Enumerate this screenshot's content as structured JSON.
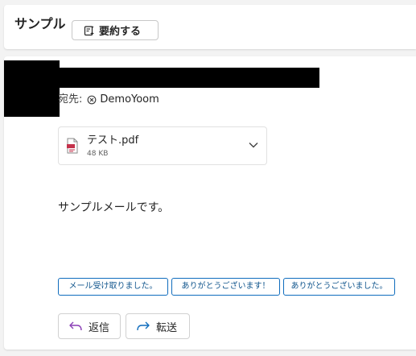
{
  "header": {
    "subject": "サンプル",
    "summarize_label": "要約する"
  },
  "message": {
    "to_label": "宛先:",
    "recipient": "DemoYoom",
    "attachment": {
      "name": "テスト.pdf",
      "size": "48 KB"
    },
    "body": "サンプルメールです。"
  },
  "quick_replies": [
    {
      "label": "メール受け取りました。"
    },
    {
      "label": "ありがとうございます！"
    },
    {
      "label": "ありがとうございました。"
    }
  ],
  "actions": {
    "reply_label": "返信",
    "forward_label": "転送"
  },
  "colors": {
    "accent": "#0f6cbd",
    "reply_icon": "#8a3fb5",
    "forward_icon": "#0f6cbd",
    "pdf_red": "#c4314b"
  }
}
